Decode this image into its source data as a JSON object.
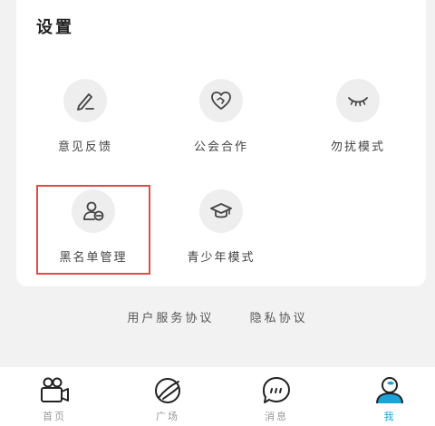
{
  "settings": {
    "title": "设置",
    "items": [
      {
        "label": "意见反馈",
        "icon": "pencil-icon"
      },
      {
        "label": "公会合作",
        "icon": "handshake-heart-icon"
      },
      {
        "label": "勿扰模式",
        "icon": "closed-eye-icon"
      },
      {
        "label": "黑名单管理",
        "icon": "user-block-icon"
      },
      {
        "label": "青少年模式",
        "icon": "graduation-cap-icon"
      }
    ]
  },
  "links": {
    "user_agreement": "用户服务协议",
    "privacy_agreement": "隐私协议"
  },
  "tabbar": {
    "items": [
      {
        "label": "首页",
        "icon": "video-camera-icon"
      },
      {
        "label": "广场",
        "icon": "planet-icon"
      },
      {
        "label": "消息",
        "icon": "chat-bubble-icon"
      },
      {
        "label": "我",
        "icon": "profile-icon",
        "active": true
      }
    ]
  },
  "colors": {
    "highlight_border": "#e24b4b",
    "active_tab": "#1aa3d8"
  }
}
